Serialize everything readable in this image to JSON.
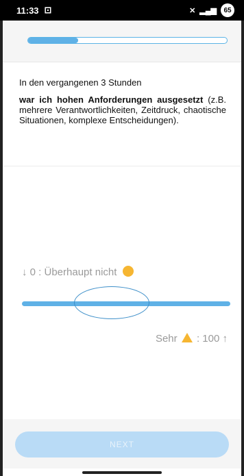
{
  "status_bar": {
    "time": "11:33",
    "battery": "65"
  },
  "progress": {
    "fraction": 0.25
  },
  "question": {
    "intro": "In den vergangenen 3 Stunden",
    "bold_text": "war ich hohen Anforderungen ausgesetzt",
    "detail_text": "(z.B. mehrere Verantwortlichkeiten, Zeitdruck, chaotische Situationen, komplexe Entscheidungen)."
  },
  "slider": {
    "low_label": "↓ 0 : Überhaupt nicht",
    "high_prefix": "Sehr",
    "high_suffix": ": 100 ↑",
    "value_fraction": 0.43,
    "low_icon": "smile-emoji-icon",
    "high_icon": "warning-icon"
  },
  "footer": {
    "next_label": "NEXT"
  },
  "colors": {
    "accent": "#5fb1e6",
    "button": "#b9dbf6"
  }
}
